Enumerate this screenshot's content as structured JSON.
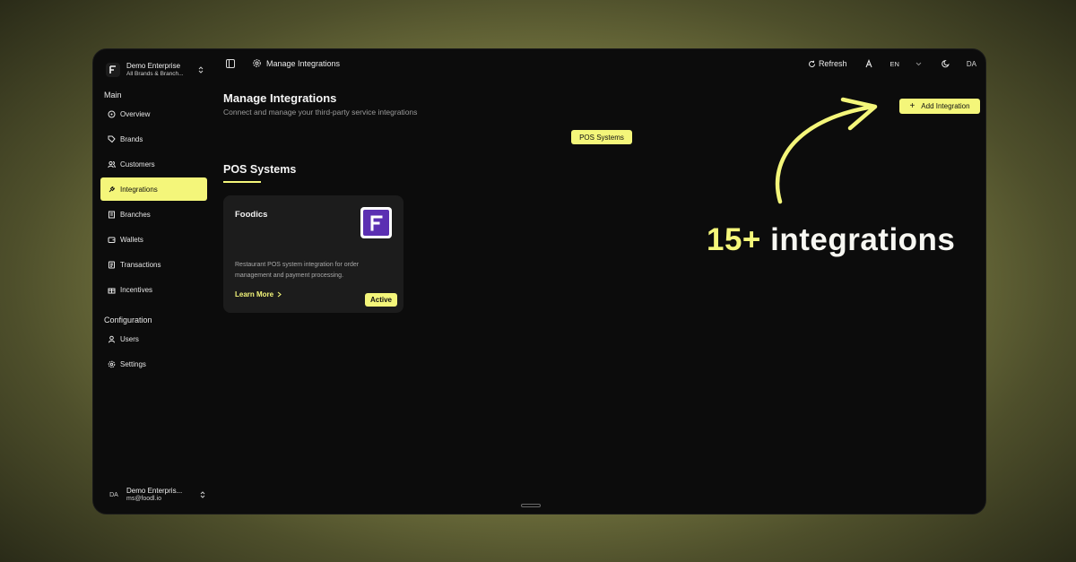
{
  "org": {
    "name": "Demo Enterprise",
    "scope": "All Brands & Branch..."
  },
  "sidebar": {
    "main_label": "Main",
    "main_items": [
      {
        "label": "Overview",
        "icon": "overview-icon"
      },
      {
        "label": "Brands",
        "icon": "tag-icon"
      },
      {
        "label": "Customers",
        "icon": "users-icon"
      },
      {
        "label": "Integrations",
        "icon": "plug-icon",
        "active": true
      },
      {
        "label": "Branches",
        "icon": "building-icon"
      },
      {
        "label": "Wallets",
        "icon": "wallet-icon"
      },
      {
        "label": "Transactions",
        "icon": "receipt-icon"
      },
      {
        "label": "Incentives",
        "icon": "gift-icon"
      }
    ],
    "config_label": "Configuration",
    "config_items": [
      {
        "label": "Users",
        "icon": "user-icon"
      },
      {
        "label": "Settings",
        "icon": "gear-icon"
      }
    ]
  },
  "user": {
    "initials": "DA",
    "name": "Demo Enterpris...",
    "email": "ms@foodl.io"
  },
  "topbar": {
    "breadcrumb": "Manage Integrations",
    "refresh_label": "Refresh",
    "language": "EN",
    "avatar": "DA"
  },
  "page": {
    "title": "Manage Integrations",
    "subtitle": "Connect and manage your third-party service integrations",
    "add_button": "Add Integration",
    "filter_chip": "POS Systems",
    "section_title": "POS Systems"
  },
  "integration_card": {
    "name": "Foodics",
    "description": "Restaurant POS system integration for order management and payment processing.",
    "link": "Learn More",
    "status": "Active"
  },
  "promo": {
    "highlight": "15+",
    "text": " integrations"
  },
  "colors": {
    "accent": "#f4f67a",
    "background": "#0c0c0c",
    "card": "#1c1c1c",
    "foodics_brand": "#5b2fb2"
  }
}
